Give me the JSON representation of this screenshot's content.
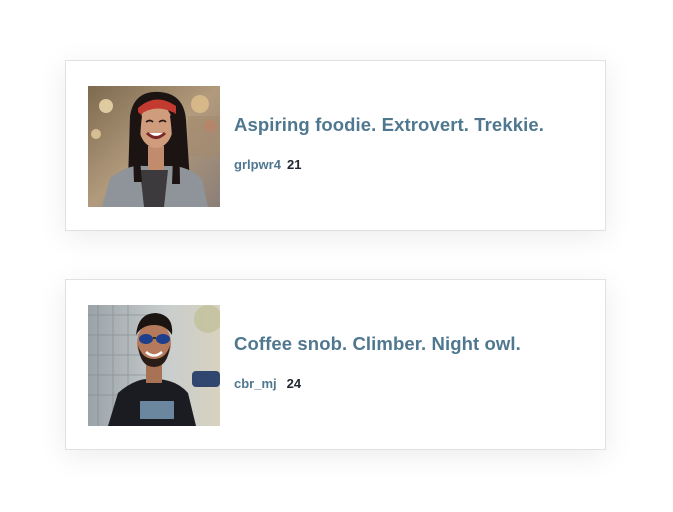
{
  "profiles": [
    {
      "photo": "profile-photo-woman",
      "bio": "Aspiring foodie. Extrovert. Trekkie.",
      "username": "grlpwr4",
      "age": "21"
    },
    {
      "photo": "profile-photo-man",
      "bio": "Coffee snob. Climber. Night owl.",
      "username": "cbr_mj",
      "age": "24"
    }
  ],
  "colors": {
    "accent": "#4f7890",
    "age_text": "#222831",
    "card_border": "#dfe2e5"
  }
}
